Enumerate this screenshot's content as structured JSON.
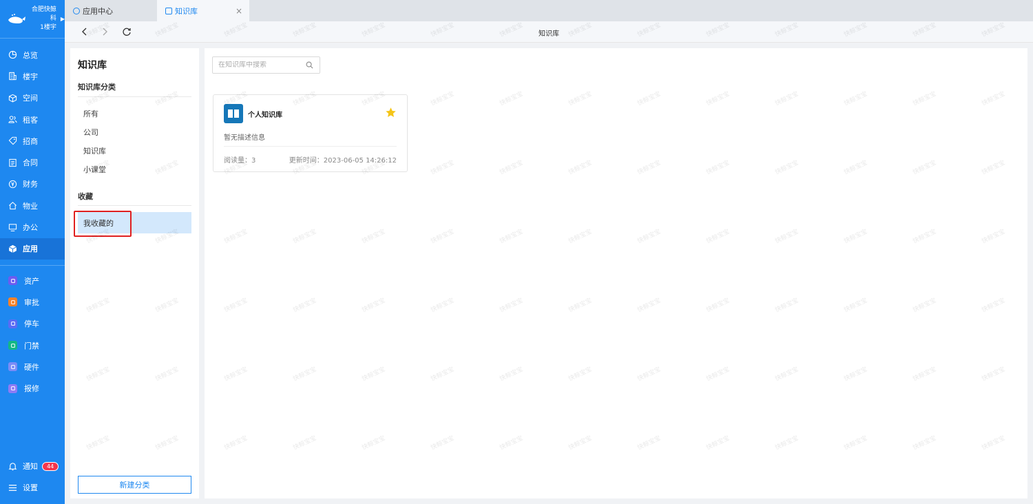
{
  "org": {
    "name": "合肥快鲸科",
    "building": "1楼宇"
  },
  "nav": {
    "items": [
      {
        "label": "总览",
        "icon": "pie-chart-icon"
      },
      {
        "label": "楼宇",
        "icon": "building-icon"
      },
      {
        "label": "空间",
        "icon": "cube-icon"
      },
      {
        "label": "租客",
        "icon": "users-icon"
      },
      {
        "label": "招商",
        "icon": "tag-icon"
      },
      {
        "label": "合同",
        "icon": "document-icon"
      },
      {
        "label": "财务",
        "icon": "yen-icon"
      },
      {
        "label": "物业",
        "icon": "home-icon"
      },
      {
        "label": "办公",
        "icon": "monitor-icon"
      },
      {
        "label": "应用",
        "icon": "app-cube-icon",
        "active": true
      }
    ],
    "apps": [
      {
        "label": "资产",
        "icon": "asset-icon",
        "color": "#6d5cf0"
      },
      {
        "label": "审批",
        "icon": "approval-icon",
        "color": "#f5822a"
      },
      {
        "label": "停车",
        "icon": "parking-icon",
        "color": "#5a6cf5"
      },
      {
        "label": "门禁",
        "icon": "access-icon",
        "color": "#12b886"
      },
      {
        "label": "硬件",
        "icon": "hardware-icon",
        "color": "#7b8cf7"
      },
      {
        "label": "报修",
        "icon": "repair-icon",
        "color": "#8e7bf5"
      }
    ],
    "notify": {
      "label": "通知",
      "count": "44"
    },
    "settings": {
      "label": "设置"
    }
  },
  "tabs": [
    {
      "label": "应用中心",
      "active": false
    },
    {
      "label": "知识库",
      "active": true
    }
  ],
  "toolbar": {
    "title": "知识库"
  },
  "categories": {
    "title": "知识库",
    "subtitle": "知识库分类",
    "items": [
      "所有",
      "公司",
      "知识库",
      "小课堂"
    ],
    "favorites_title": "收藏",
    "favorites_item": "我收藏的",
    "new_button": "新建分类"
  },
  "search": {
    "placeholder": "在知识库中搜索"
  },
  "card": {
    "name": "个人知识库",
    "description": "暂无描述信息",
    "reads": "阅读量：3",
    "updated": "更新时间：2023-06-05 14:26:12",
    "starred": true
  },
  "watermark": {
    "text": "快鲸宝宝"
  },
  "colors": {
    "primary": "#1e88f0",
    "highlight": "#e02020",
    "star": "#f5c518",
    "selected": "#d3e8fc"
  }
}
